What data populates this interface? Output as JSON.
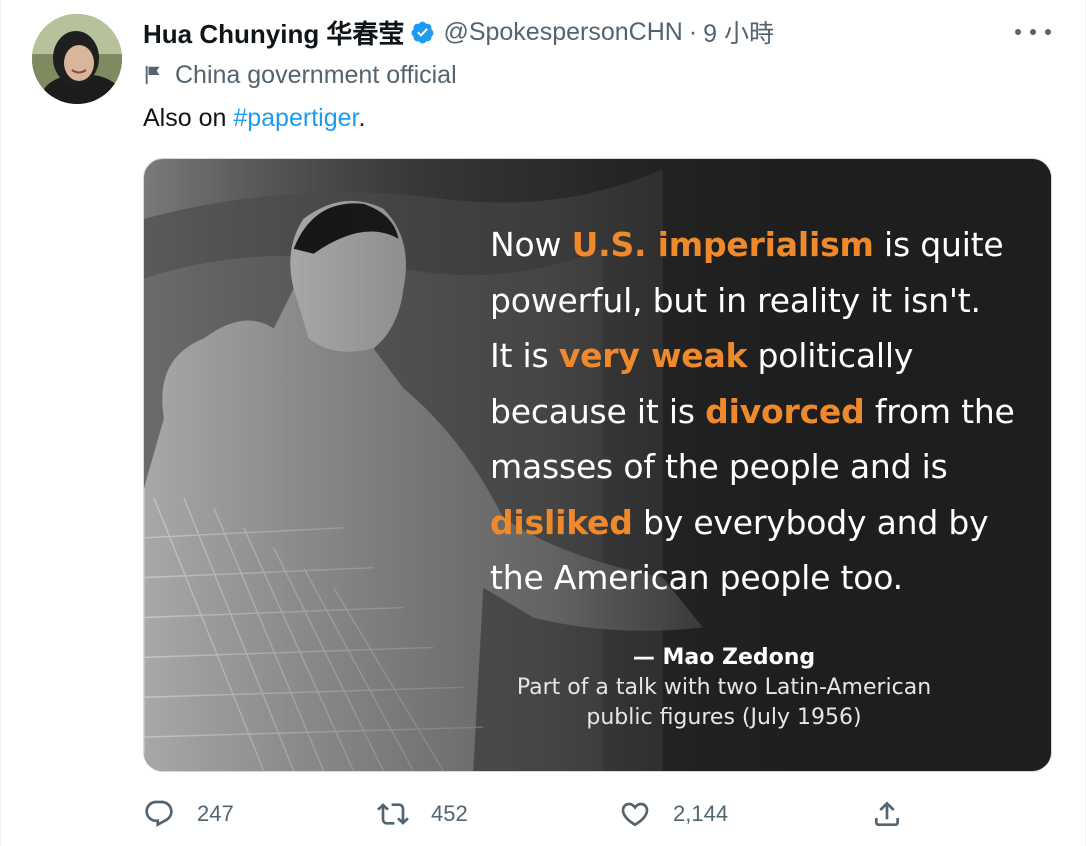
{
  "tweet": {
    "author_name": "Hua Chunying 华春莹",
    "handle": "@SpokespersonCHN",
    "separator": "·",
    "time": "9 小時",
    "label": "China government official",
    "text_prefix": "Also on ",
    "hashtag": "#papertiger",
    "text_suffix": "."
  },
  "media": {
    "quote_parts": [
      {
        "t": "Now ",
        "h": false
      },
      {
        "t": "U.S. imperialism",
        "h": true
      },
      {
        "t": " is quite powerful, but in reality it isn't. It is ",
        "h": false
      },
      {
        "t": "very weak",
        "h": true
      },
      {
        "t": " politically because it is ",
        "h": false
      },
      {
        "t": "divorced",
        "h": true
      },
      {
        "t": " from the masses of the people and is ",
        "h": false
      },
      {
        "t": "disliked",
        "h": true
      },
      {
        "t": " by everybody and by the American people too.",
        "h": false
      }
    ],
    "quote_lines": [
      [
        {
          "t": "Now ",
          "h": false
        },
        {
          "t": "U.S. imperialism",
          "h": true
        },
        {
          "t": " is quite",
          "h": false
        }
      ],
      [
        {
          "t": "powerful, but in reality it isn't.",
          "h": false
        }
      ],
      [
        {
          "t": "It is ",
          "h": false
        },
        {
          "t": "very weak",
          "h": true
        },
        {
          "t": " politically",
          "h": false
        }
      ],
      [
        {
          "t": "because it is ",
          "h": false
        },
        {
          "t": "divorced",
          "h": true
        },
        {
          "t": " from the",
          "h": false
        }
      ],
      [
        {
          "t": "masses of the people and is",
          "h": false
        }
      ],
      [
        {
          "t": "disliked",
          "h": true
        },
        {
          "t": " by everybody and by",
          "h": false
        }
      ],
      [
        {
          "t": "the American people too.",
          "h": false
        }
      ]
    ],
    "author": "— Mao Zedong",
    "source_line1": "Part of a talk with two Latin-American",
    "source_line2": "public figures (July 1956)",
    "highlight_color": "#ef8a2c"
  },
  "actions": {
    "reply_count": "247",
    "retweet_count": "452",
    "like_count": "2,144"
  },
  "icons": {
    "verified": "verified-badge-icon",
    "flag": "flag-icon",
    "more": "more-icon",
    "reply": "reply-icon",
    "retweet": "retweet-icon",
    "like": "heart-icon",
    "share": "share-icon"
  },
  "colors": {
    "accent": "#1d9bf0",
    "secondary_text": "#536471"
  }
}
